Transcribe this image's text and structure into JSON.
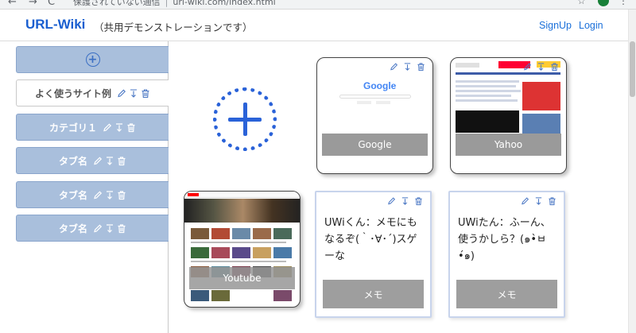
{
  "browser": {
    "back_glyph": "←",
    "forward_glyph": "→",
    "reload_glyph": "C",
    "security_warning": "保護されていない通信",
    "url": "url-wiki.com/index.html",
    "menu_glyph": "⋮",
    "avatar_letter": "p"
  },
  "header": {
    "brand": "URL-Wiki",
    "subtitle": "（共用デモンストレーションです）",
    "signup": "SignUp",
    "login": "Login"
  },
  "sidebar": {
    "add_glyph": "+",
    "items": [
      {
        "label": "よく使うサイト例",
        "active": true
      },
      {
        "label": "カテゴリ１",
        "active": false
      },
      {
        "label": "タブ名",
        "active": false
      },
      {
        "label": "タブ名",
        "active": false
      },
      {
        "label": "タブ名",
        "active": false
      }
    ]
  },
  "cards": [
    {
      "type": "link",
      "caption": "Google",
      "thumbnail_logo": "Google"
    },
    {
      "type": "link",
      "caption": "Yahoo"
    },
    {
      "type": "link",
      "caption": "Youtube"
    },
    {
      "type": "memo",
      "caption": "メモ",
      "text": "UWiくん：メモにもなるぞ(｀･∀･´)スゲーな"
    },
    {
      "type": "memo",
      "caption": "メモ",
      "text": "UWiたん：ふーん、使うかしら？(๑•̀ㅂ•́๑)"
    }
  ],
  "colors": {
    "accent": "#1a5fd0",
    "tab_bg": "#a9bfdc",
    "caption_bg": "#9a9a9a",
    "add_button": "#2a62d8"
  },
  "icons": [
    "pencil-icon",
    "arrow-down-icon",
    "trash-icon",
    "plus-circle-icon",
    "plus-big-icon"
  ]
}
